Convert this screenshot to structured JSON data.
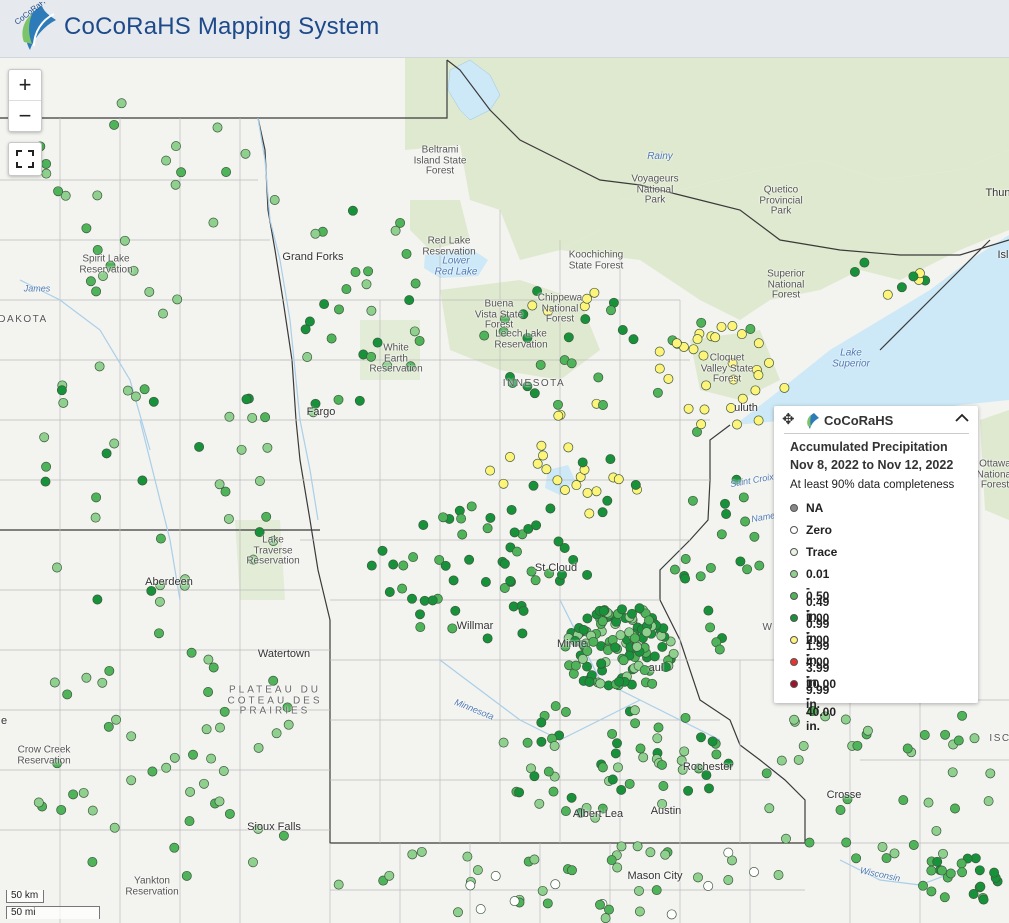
{
  "app": {
    "title": "CoCoRaHS Mapping System",
    "logo_icon": "cocorahs-logo",
    "logo_text": "CoCoRaHS"
  },
  "controls": {
    "zoom_in": "+",
    "zoom_out": "−",
    "fullscreen_icon": "fullscreen-icon"
  },
  "legend": {
    "brand": "CoCoRaHS",
    "title": "Accumulated Precipitation",
    "dates": "Nov 8, 2022 to Nov 12, 2022",
    "note": "At least 90% data completeness",
    "classes": [
      {
        "label": "NA",
        "color": "#888888"
      },
      {
        "label": "Zero",
        "color": "#ffffff"
      },
      {
        "label": "Trace",
        "color": "#e8f3e4"
      },
      {
        "label": "0.01 - 0.49 in.",
        "color": "#8fd08f"
      },
      {
        "label": "0.50 - 0.99 in.",
        "color": "#4fb35a"
      },
      {
        "label": "1.00 - 1.99 in.",
        "color": "#17913a"
      },
      {
        "label": "2.00 - 3.99 in.",
        "color": "#fff47a"
      },
      {
        "label": "4.00 - 9.99 in.",
        "color": "#e8352b"
      },
      {
        "label": "10.00 - 40.00 in.",
        "color": "#a0112a"
      }
    ]
  },
  "scale": {
    "km": "50 km",
    "mi": "50 mi"
  },
  "map_labels": {
    "grand_forks": "Grand Forks",
    "fargo": "Fargo",
    "aberdeen": "Aberdeen",
    "watertown": "Watertown",
    "sioux_falls": "Sioux Falls",
    "st_cloud": "St Cloud",
    "willmar": "Willmar",
    "minneapolis": "Minne",
    "st_paul": "aul",
    "rochester": "Rochester",
    "albert_lea": "Albert Lea",
    "austin": "Austin",
    "mason_city": "Mason City",
    "la_crosse": "Crosse",
    "duluth": "uluth",
    "thunder_bay": "Thun",
    "dakota": "DAKOTA",
    "minnesota_state": "INNESOTA",
    "beltrami": "Beltrami\nIsland State\nForest",
    "voyageurs": "Voyageurs\nNational\nPark",
    "quetico": "Quetico\nProvincial\nPark",
    "red_lake_res": "Red Lake\nReservation",
    "lower_red_lake": "Lower\nRed Lake",
    "koochiching": "Koochiching\nState Forest",
    "superior_nf": "Superior\nNational\nForest",
    "buena_vista": "Buena\nVista State\nForest",
    "chippewa_nf": "Chippewa\nNational\nForest",
    "leech_lake": "Leech Lake\nReservation",
    "white_earth": "White\nEarth\nReservation",
    "cloquet": "Cloquet\nValley State\nForest",
    "spirit_lake": "Spirit Lake\nReservation",
    "lake_traverse": "Lake\nTraverse\nReservation",
    "coteau": "PLATEAU DU\nCOTEAU DES\nPRAIRIES",
    "crow_creek": "Crow Creek\nReservation",
    "yankton": "Yankton\nReservation",
    "rainy": "Rainy",
    "lake_superior": "Lake\nSuperior",
    "james": "James",
    "minnesota_river": "Minnesota",
    "saint_croix": "Saint Croix",
    "wisconsin": "Wisconsin",
    "ottawa": "Ottawa\nNational\nForest",
    "namekagon": "Nameka",
    "isle": "Isl",
    "wi_label": "W",
    "isc": "ISC",
    "e_label": "e"
  }
}
